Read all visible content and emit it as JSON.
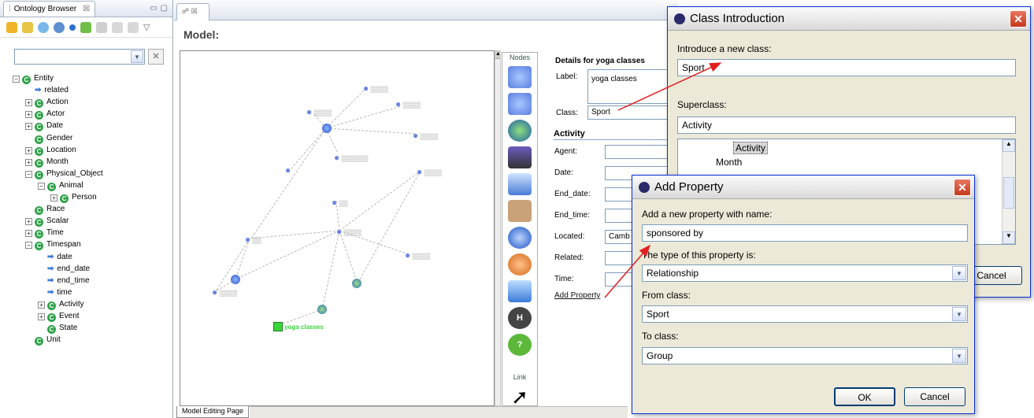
{
  "ontology_browser": {
    "tab_title": "Ontology Browser",
    "tab_close": "☒",
    "tree": [
      {
        "label": "Entity",
        "type": "class",
        "expander": "minus",
        "indent": 0
      },
      {
        "label": "related",
        "type": "property",
        "indent": 1
      },
      {
        "label": "Action",
        "type": "class",
        "expander": "plus",
        "indent": 1
      },
      {
        "label": "Actor",
        "type": "class",
        "expander": "plus",
        "indent": 1
      },
      {
        "label": "Date",
        "type": "class",
        "expander": "plus",
        "indent": 1
      },
      {
        "label": "Gender",
        "type": "class",
        "indent": 1
      },
      {
        "label": "Location",
        "type": "class",
        "expander": "plus",
        "indent": 1
      },
      {
        "label": "Month",
        "type": "class",
        "expander": "plus",
        "indent": 1
      },
      {
        "label": "Physical_Object",
        "type": "class",
        "expander": "minus",
        "indent": 1
      },
      {
        "label": "Animal",
        "type": "class",
        "expander": "minus",
        "indent": 2
      },
      {
        "label": "Person",
        "type": "class",
        "expander": "plus",
        "indent": 3
      },
      {
        "label": "Race",
        "type": "class",
        "indent": 1
      },
      {
        "label": "Scalar",
        "type": "class",
        "expander": "plus",
        "indent": 1
      },
      {
        "label": "Time",
        "type": "class",
        "expander": "plus",
        "indent": 1
      },
      {
        "label": "Timespan",
        "type": "class",
        "expander": "minus",
        "indent": 1
      },
      {
        "label": "date",
        "type": "property",
        "indent": 2
      },
      {
        "label": "end_date",
        "type": "property",
        "indent": 2
      },
      {
        "label": "end_time",
        "type": "property",
        "indent": 2
      },
      {
        "label": "time",
        "type": "property",
        "indent": 2
      },
      {
        "label": "Activity",
        "type": "class",
        "expander": "plus",
        "indent": 2
      },
      {
        "label": "Event",
        "type": "class",
        "expander": "plus",
        "indent": 2
      },
      {
        "label": "State",
        "type": "class",
        "indent": 2
      },
      {
        "label": "Unit",
        "type": "class",
        "indent": 1
      }
    ]
  },
  "model_editor": {
    "tab_title": "☍ ☒",
    "heading": "Model:",
    "bottom_tab": "Model Editing Page",
    "highlight_node": "yoga classes",
    "palette_nodes_label": "Nodes",
    "palette_link_label": "Link",
    "details": {
      "title": "Details for yoga classes",
      "label_label": "Label:",
      "label_value": "yoga classes",
      "class_label": "Class:",
      "class_value": "Sport",
      "section": "Activity",
      "fields": [
        "Agent:",
        "Date:",
        "End_date:",
        "End_time:",
        "Located:",
        "Related:",
        "Time:"
      ],
      "located_value": "Camb",
      "add_property": "Add Property"
    }
  },
  "class_intro": {
    "title": "Class Introduction",
    "prompt": "Introduce a new class:",
    "value": "Sport",
    "superclass_label": "Superclass:",
    "superclass_value": "Activity",
    "tree_selected": "Activity",
    "tree_item2": "Month",
    "cancel": "Cancel"
  },
  "add_property": {
    "title": "Add Property",
    "prompt": "Add a new property with name:",
    "name_value": "sponsored by",
    "type_label": "The type of this property is:",
    "type_value": "Relationship",
    "from_label": "From class:",
    "from_value": "Sport",
    "to_label": "To class:",
    "to_value": "Group",
    "ok": "OK",
    "cancel": "Cancel"
  },
  "colors": {
    "class_icon": "#2fa34a",
    "property_icon": "#3b7ddd",
    "annotation_arrow": "#e41e1e",
    "highlight_node": "#3bd63b"
  }
}
